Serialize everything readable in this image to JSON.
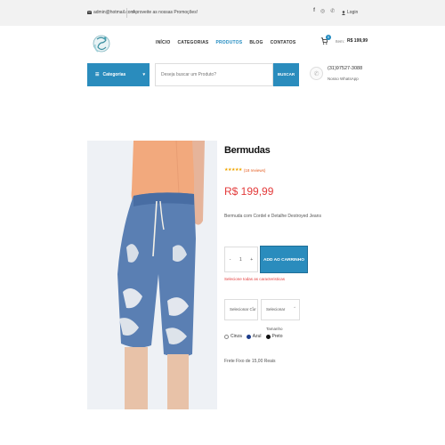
{
  "topbar": {
    "email": "admin@hotmail.com",
    "promo": "Aproveite as nossas Promoções!",
    "login": "Login",
    "social_icons": [
      "facebook-icon",
      "instagram-icon",
      "whatsapp-icon"
    ]
  },
  "nav": {
    "items": [
      "INÍCIO",
      "CATEGORIAS",
      "PRODUTOS",
      "BLOG",
      "CONTATOS"
    ],
    "active": "PRODUTOS"
  },
  "cart": {
    "count": "0",
    "label": "Item:",
    "total": "R$ 199,99"
  },
  "search": {
    "categories_label": "Categorias",
    "placeholder": "Deseja buscar um Produto?",
    "button": "BUSCAR"
  },
  "whatsapp": {
    "phone": "(31)97527-3088",
    "label": "Nosso WhatsApp"
  },
  "product": {
    "title": "Bermudas",
    "rating": 5,
    "reviews": "(18 reviews)",
    "price": "R$ 199,99",
    "description": "Bermuda com Cordel e Detalhe Destroyed Jeans",
    "quantity": "1",
    "add_to_cart": "ADD AO CARRINHO",
    "warning": "Selecione todas as caracteristicas",
    "color_select": "Selecionar Cor",
    "size_select": "Selecionar Tamanho",
    "colors": [
      {
        "name": "Cinza",
        "hex": "#ffffff"
      },
      {
        "name": "Azul",
        "hex": "#1d3d8a"
      },
      {
        "name": "Preto",
        "hex": "#111111"
      }
    ],
    "shipping": "Frete Fixo de 15,00 Reais"
  },
  "colors": {
    "accent": "#2a8cbd",
    "price": "#e33b3b",
    "stars": "#f0a500"
  }
}
